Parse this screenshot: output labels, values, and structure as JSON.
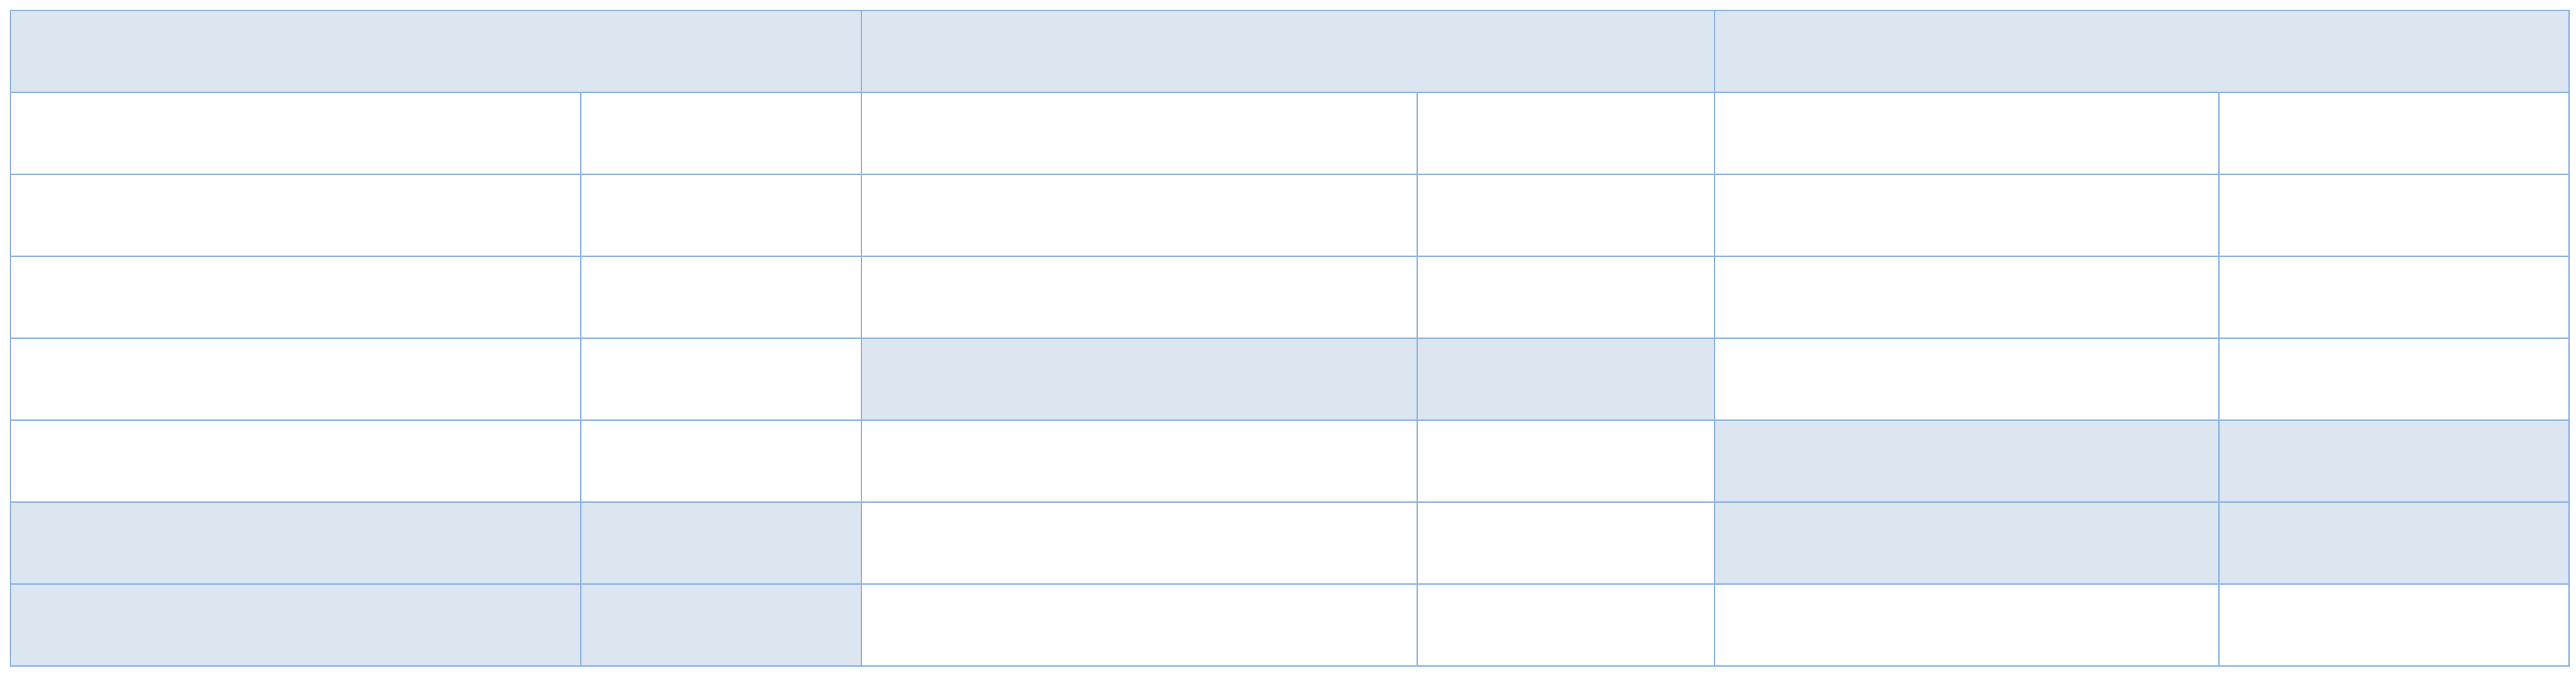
{
  "colors": {
    "border": "#8eb4e3",
    "highlight": "#dce6f1",
    "background": "#ffffff"
  },
  "table": {
    "header": [
      "",
      "",
      ""
    ],
    "rows": [
      {
        "cells": [
          "",
          "",
          "",
          "",
          "",
          ""
        ],
        "highlight": [
          false,
          false,
          false,
          false,
          false,
          false
        ]
      },
      {
        "cells": [
          "",
          "",
          "",
          "",
          "",
          ""
        ],
        "highlight": [
          false,
          false,
          false,
          false,
          false,
          false
        ]
      },
      {
        "cells": [
          "",
          "",
          "",
          "",
          "",
          ""
        ],
        "highlight": [
          false,
          false,
          false,
          false,
          false,
          false
        ]
      },
      {
        "cells": [
          "",
          "",
          "",
          "",
          "",
          ""
        ],
        "highlight": [
          false,
          false,
          true,
          true,
          false,
          false
        ]
      },
      {
        "cells": [
          "",
          "",
          "",
          "",
          "",
          ""
        ],
        "highlight": [
          false,
          false,
          false,
          false,
          true,
          true
        ]
      },
      {
        "cells": [
          "",
          "",
          "",
          "",
          "",
          ""
        ],
        "highlight": [
          true,
          true,
          false,
          false,
          true,
          true
        ]
      },
      {
        "cells": [
          "",
          "",
          "",
          "",
          "",
          ""
        ],
        "highlight": [
          true,
          true,
          false,
          false,
          false,
          false
        ]
      }
    ]
  }
}
